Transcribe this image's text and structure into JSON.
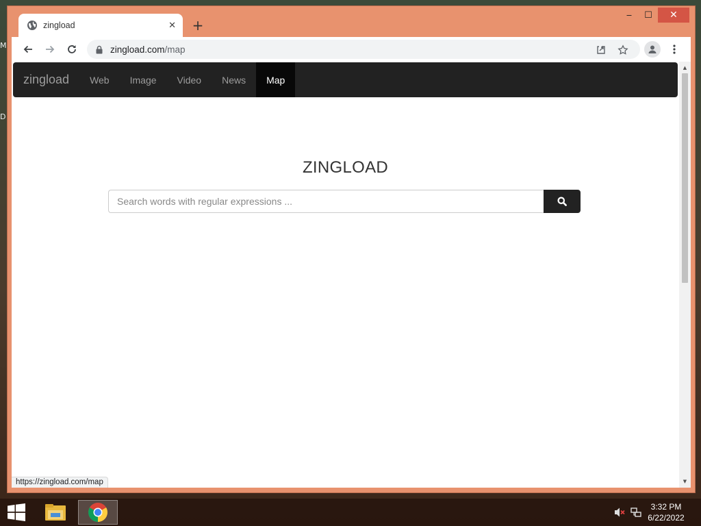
{
  "desktop": {
    "edge_glyph_1": "M",
    "edge_glyph_2": "D"
  },
  "browser": {
    "tab": {
      "title": "zingload",
      "icon": "globe-icon"
    },
    "window_controls": {
      "minimize": "‒",
      "maximize": "☐",
      "close": "✕"
    },
    "address_bar": {
      "host": "zingload.com",
      "path": "/map"
    },
    "status_url": "https://zingload.com/map"
  },
  "site": {
    "brand": "zingload",
    "nav": [
      {
        "label": "Web",
        "active": false
      },
      {
        "label": "Image",
        "active": false
      },
      {
        "label": "Video",
        "active": false
      },
      {
        "label": "News",
        "active": false
      },
      {
        "label": "Map",
        "active": true
      }
    ],
    "title": "ZINGLOAD",
    "search": {
      "placeholder": "Search words with regular expressions ...",
      "value": ""
    }
  },
  "taskbar": {
    "clock": {
      "time": "3:32 PM",
      "date": "6/22/2022"
    }
  },
  "colors": {
    "window_frame": "#e8926e",
    "navbar_bg": "#222222",
    "navbar_active_bg": "#080808",
    "close_button": "#d45545"
  }
}
